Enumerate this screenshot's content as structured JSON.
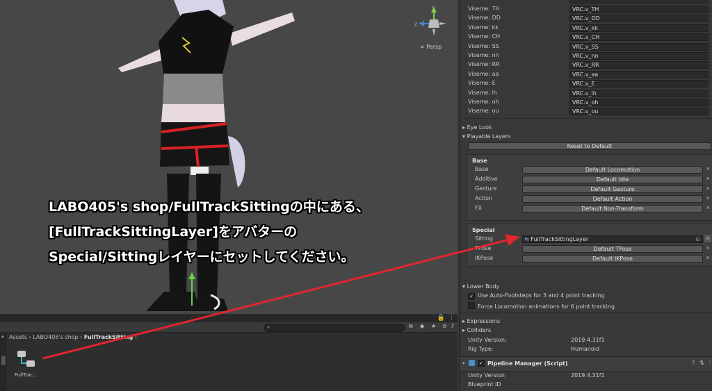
{
  "scene": {
    "persp_label": "Persp",
    "axis_y": "y",
    "axis_z": "z"
  },
  "caption": {
    "line1": "LABO405's shop/FullTrackSittingの中にある、",
    "line2": "[FullTrackSittingLayer]をアバターの",
    "line3": "Special/Sittingレイヤーにセットしてください。"
  },
  "project": {
    "breadcrumb": [
      "Assets",
      "LABO405's shop",
      "FullTrackSitting"
    ],
    "search_placeholder": "",
    "asset_name": "FullTrac...",
    "toolbar_count": "7"
  },
  "inspector": {
    "visemes": [
      {
        "label": "Viseme: TH",
        "value": "VRC.v_TH"
      },
      {
        "label": "Viseme: DD",
        "value": "VRC.v_DD"
      },
      {
        "label": "Viseme: kk",
        "value": "VRC.v_kk"
      },
      {
        "label": "Viseme: CH",
        "value": "VRC.v_CH"
      },
      {
        "label": "Viseme: SS",
        "value": "VRC.v_SS"
      },
      {
        "label": "Viseme: nn",
        "value": "VRC.v_nn"
      },
      {
        "label": "Viseme: RR",
        "value": "VRC.v_RR"
      },
      {
        "label": "Viseme: aa",
        "value": "VRC.v_aa"
      },
      {
        "label": "Viseme: E",
        "value": "VRC.v_E"
      },
      {
        "label": "Viseme: ih",
        "value": "VRC.v_ih"
      },
      {
        "label": "Viseme: oh",
        "value": "VRC.v_oh"
      },
      {
        "label": "Viseme: ou",
        "value": "VRC.v_ou"
      }
    ],
    "eye_look": "Eye Look",
    "playable_layers": "Playable Layers",
    "reset_button": "Reset to Default",
    "base_title": "Base",
    "base_layers": [
      {
        "label": "Base",
        "value": "Default Locomotion"
      },
      {
        "label": "Additive",
        "value": "Default Idle"
      },
      {
        "label": "Gesture",
        "value": "Default Gesture"
      },
      {
        "label": "Action",
        "value": "Default Action"
      },
      {
        "label": "FX",
        "value": "Default Non-Transform"
      }
    ],
    "special_title": "Special",
    "special_layers": [
      {
        "label": "Sitting",
        "value": "FullTrackSittingLayer"
      },
      {
        "label": "TPose",
        "value": "Default TPose"
      },
      {
        "label": "IKPose",
        "value": "Default IKPose"
      }
    ],
    "lower_body": "Lower Body",
    "auto_footsteps": "Use Auto-Footsteps for 3 and 4 point tracking",
    "force_locomotion": "Force Locomotion animations for 6 point tracking",
    "expressions": "Expressions",
    "colliders": "Colliders",
    "unity_version_label": "Unity Version:",
    "unity_version_value": "2019.4.31f1",
    "rig_type_label": "Rig Type:",
    "rig_type_value": "Humanoid",
    "pipeline_title": "Pipeline Manager (Script)",
    "pipeline_unity_label": "Unity Version",
    "pipeline_unity_value": "2019.4.31f1",
    "blueprint_label": "Blueprint ID",
    "remove_x": "x"
  },
  "colors": {
    "arrow": "#e0262e",
    "accent_tie": "#e02020"
  }
}
